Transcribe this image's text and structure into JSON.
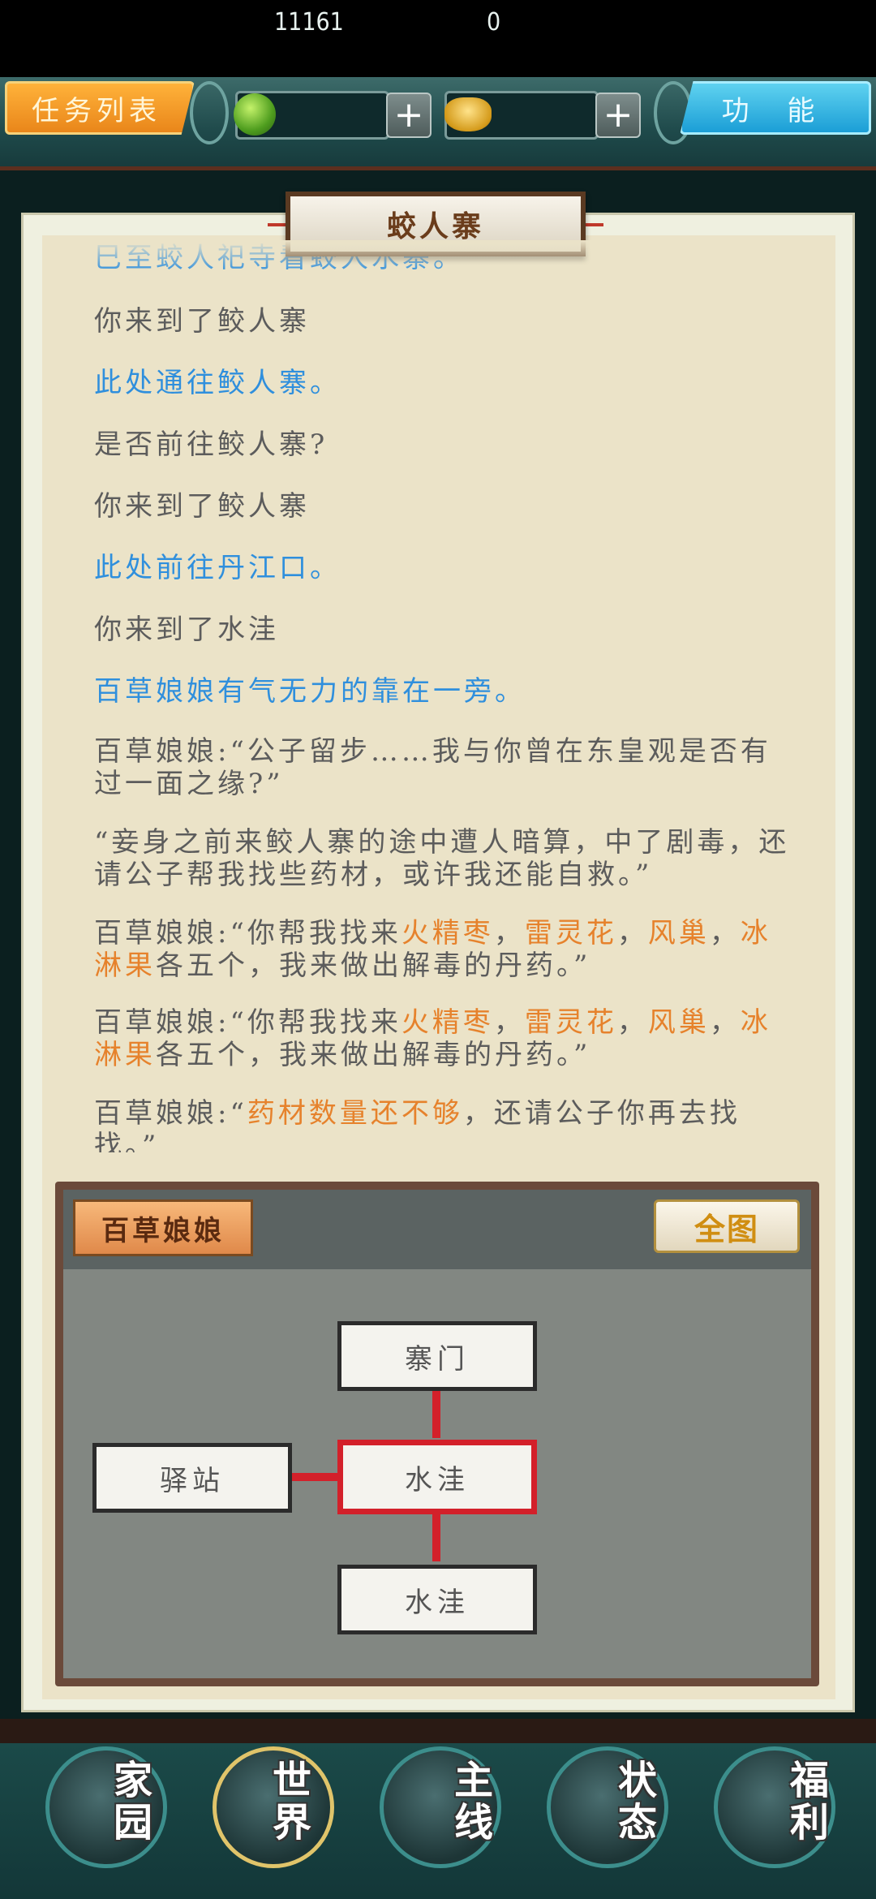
{
  "topbar": {
    "task_list": "任务列表",
    "function": "功 能",
    "jade_amount": "11161",
    "gold_amount": "0",
    "plus": "+"
  },
  "panel": {
    "title": "蛟人寨",
    "log": [
      {
        "segments": [
          {
            "text": "巳至蛟人祀寺看蛟人水寨。",
            "color": "blue"
          }
        ]
      },
      {
        "segments": [
          {
            "text": "你来到了鲛人寨",
            "color": "gray"
          }
        ]
      },
      {
        "segments": [
          {
            "text": "此处通往鲛人寨。",
            "color": "blue"
          }
        ]
      },
      {
        "segments": [
          {
            "text": "是否前往鲛人寨?",
            "color": "gray"
          }
        ]
      },
      {
        "segments": [
          {
            "text": "你来到了鲛人寨",
            "color": "gray"
          }
        ]
      },
      {
        "segments": [
          {
            "text": "此处前往丹江口。",
            "color": "blue"
          }
        ]
      },
      {
        "segments": [
          {
            "text": "你来到了水洼",
            "color": "gray"
          }
        ]
      },
      {
        "segments": [
          {
            "text": "百草娘娘有气无力的靠在一旁。",
            "color": "blue"
          }
        ]
      },
      {
        "segments": [
          {
            "text": "百草娘娘:“公子留步……我与你曾在东皇观是否有过一面之缘?”",
            "color": "gray"
          }
        ]
      },
      {
        "segments": [
          {
            "text": "“妾身之前来鲛人寨的途中遭人暗算，中了剧毒，还请公子帮我找些药材，或许我还能自救。”",
            "color": "gray"
          }
        ]
      },
      {
        "segments": [
          {
            "text": "百草娘娘:“你帮我找来",
            "color": "gray"
          },
          {
            "text": "火精枣",
            "color": "orange"
          },
          {
            "text": "，",
            "color": "gray"
          },
          {
            "text": "雷灵花",
            "color": "orange"
          },
          {
            "text": "，",
            "color": "gray"
          },
          {
            "text": "风巢",
            "color": "orange"
          },
          {
            "text": "，",
            "color": "gray"
          },
          {
            "text": "冰淋果",
            "color": "orange"
          },
          {
            "text": "各五个，我来做出解毒的丹药。”",
            "color": "gray"
          }
        ]
      },
      {
        "segments": [
          {
            "text": "百草娘娘:“你帮我找来",
            "color": "gray"
          },
          {
            "text": "火精枣",
            "color": "orange"
          },
          {
            "text": "，",
            "color": "gray"
          },
          {
            "text": "雷灵花",
            "color": "orange"
          },
          {
            "text": "，",
            "color": "gray"
          },
          {
            "text": "风巢",
            "color": "orange"
          },
          {
            "text": "，",
            "color": "gray"
          },
          {
            "text": "冰淋果",
            "color": "orange"
          },
          {
            "text": "各五个，我来做出解毒的丹药。”",
            "color": "gray"
          }
        ]
      },
      {
        "segments": [
          {
            "text": "百草娘娘:“",
            "color": "gray"
          },
          {
            "text": "药材数量还不够",
            "color": "orange"
          },
          {
            "text": "，还请公子你再去找找。”",
            "color": "gray"
          }
        ]
      }
    ]
  },
  "map": {
    "npc": "百草娘娘",
    "full_map": "全图",
    "nodes": {
      "north": "寨门",
      "west": "驿站",
      "center": "水洼",
      "south": "水洼"
    },
    "current": "center"
  },
  "bottom_nav": [
    {
      "label_a": "家",
      "label_b": "园",
      "icon": "home-icon"
    },
    {
      "label_a": "世",
      "label_b": "界",
      "icon": "world-icon"
    },
    {
      "label_a": "主",
      "label_b": "线",
      "icon": "main-quest-icon"
    },
    {
      "label_a": "状",
      "label_b": "态",
      "icon": "status-icon"
    },
    {
      "label_a": "福",
      "label_b": "利",
      "icon": "welfare-icon"
    }
  ],
  "colors": {
    "blue": "#2f8fdd",
    "orange": "#e6822c",
    "gray": "#5c5c5c",
    "active_node": "#d3202a"
  }
}
